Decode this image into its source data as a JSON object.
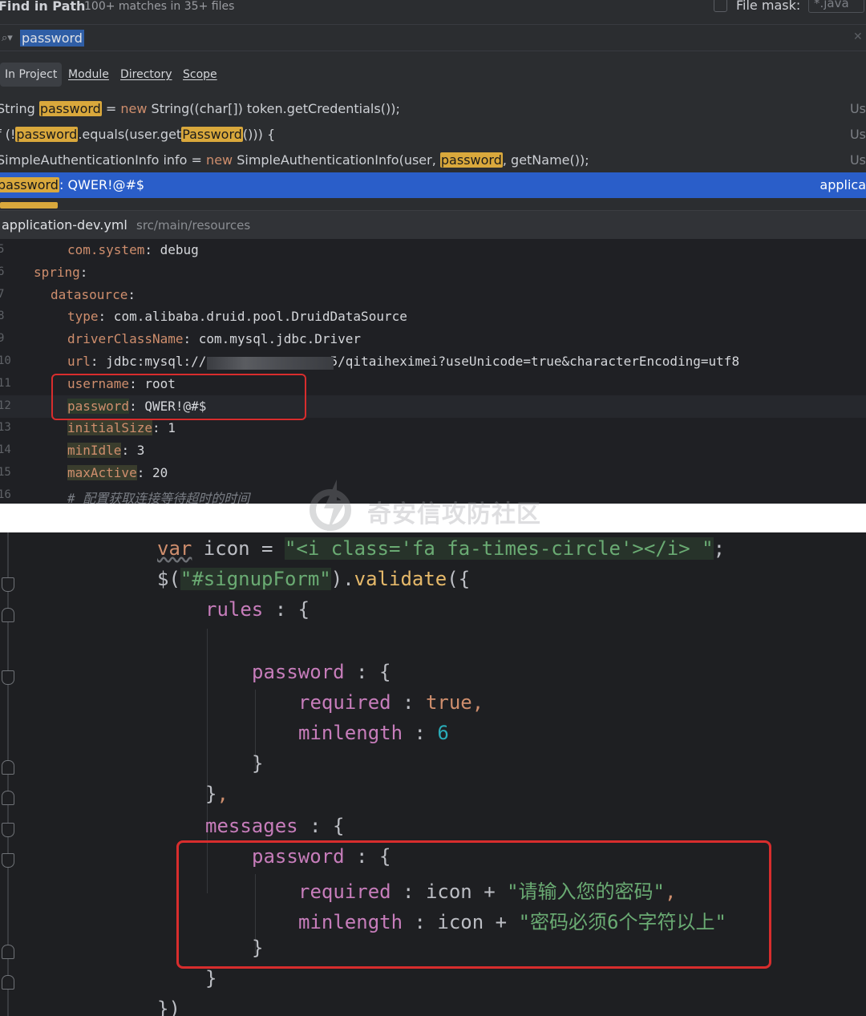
{
  "find": {
    "title": "Find in Path",
    "matches": "100+ matches in 35+ files",
    "file_mask_label": "File mask:",
    "file_mask_value": "*.java",
    "query": "password",
    "scopes": [
      "In Project",
      "Module",
      "Directory",
      "Scope"
    ],
    "active_scope": "In Project",
    "results": [
      {
        "pre": "String ",
        "hit": "password",
        "post_kw_pre": " = ",
        "kw": "new",
        "post": " String((char[]) token.getCredentials());",
        "use": "Us"
      },
      {
        "pre": "f (!",
        "hit": "password",
        "mid": ".equals(user.get",
        "hit2": "Password",
        "post": "())) {",
        "use": "Us"
      },
      {
        "pre": "SimpleAuthenticationInfo info = ",
        "kw": "new",
        "mid": " SimpleAuthenticationInfo(user, ",
        "hit": "password",
        "post": ", getName());",
        "use": "Us"
      },
      {
        "hit": "password",
        "post": ": QWER!@#$",
        "use": "applica"
      }
    ]
  },
  "file_bar": {
    "name": "application-dev.yml",
    "path": "src/main/resources"
  },
  "yaml": {
    "lines": [
      {
        "n": "5",
        "indent": 84,
        "key": "com.system",
        "val": " debug"
      },
      {
        "n": "6",
        "indent": 42,
        "key": "spring",
        "val": ""
      },
      {
        "n": "7",
        "indent": 63,
        "key": "datasource",
        "val": ""
      },
      {
        "n": "8",
        "indent": 84,
        "key": "type",
        "val": " com.alibaba.druid.pool.DruidDataSource"
      },
      {
        "n": "9",
        "indent": 84,
        "key": "driverClassName",
        "val": " com.mysql.jdbc.Driver"
      },
      {
        "n": "10",
        "indent": 84,
        "key": "url",
        "val": " jdbc:mysql://                5/qitaiheximei?useUnicode=true&characterEncoding=utf8"
      },
      {
        "n": "11",
        "indent": 84,
        "key": "username",
        "val": " root"
      },
      {
        "n": "12",
        "indent": 84,
        "key": "password",
        "val": " QWER!@#$"
      },
      {
        "n": "13",
        "indent": 84,
        "key": "initialSize",
        "val": " 1"
      },
      {
        "n": "14",
        "indent": 84,
        "key": "minIdle",
        "val": " 3"
      },
      {
        "n": "15",
        "indent": 84,
        "key": "maxActive",
        "val": " 20"
      },
      {
        "n": "16",
        "indent": 84,
        "comment": "# 配置获取连接等待超时的时间"
      }
    ]
  },
  "watermark": "奇安信攻防社区",
  "js": {
    "line1_kw": "var",
    "line1_id": " icon = ",
    "line1_str": "\"<i class='fa fa-times-circle'></i> \"",
    "line1_end": ";",
    "line2_pre": "$(",
    "line2_str": "\"#signupForm\"",
    "line2_mid": ").",
    "line2_fn": "validate",
    "line2_end": "({",
    "rules": "rules",
    "messages": "messages",
    "password": "password",
    "required": "required",
    "minlength": "minlength",
    "true_val": "true",
    "six": "6",
    "icon": "icon",
    "msg_required": "\"请输入您的密码\"",
    "msg_minlength": "\"密码必须6个字符以上\""
  },
  "colors": {
    "selection": "#2a5ec9",
    "highlight": "#d9a83c",
    "redbox": "#d82d2d"
  }
}
